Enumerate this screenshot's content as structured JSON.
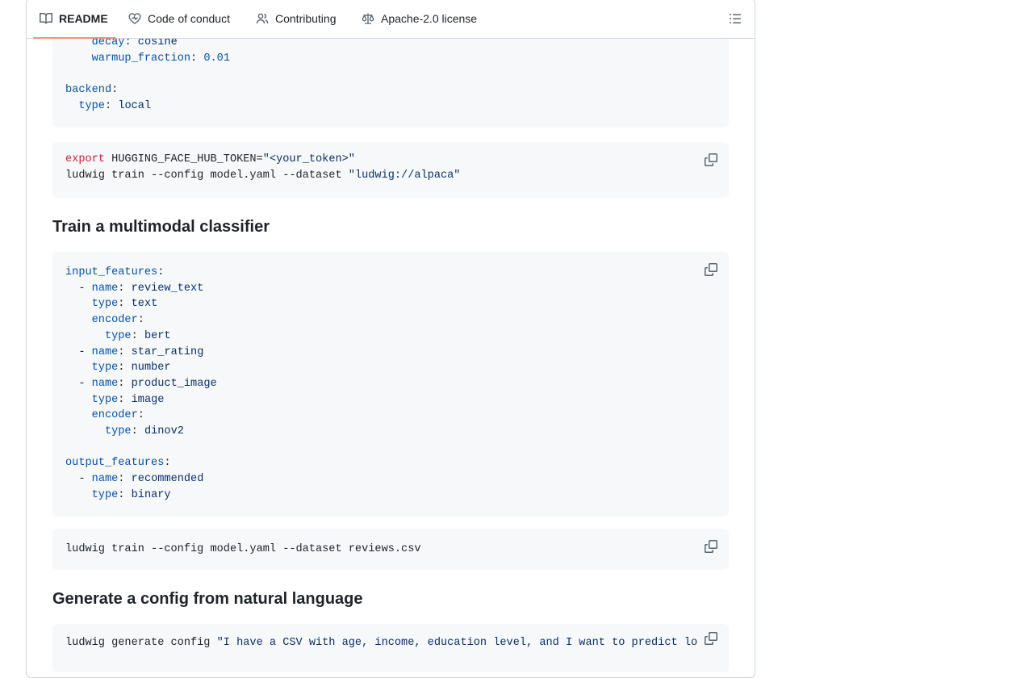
{
  "tabs": [
    {
      "label": "README",
      "icon": "book-icon",
      "active": true
    },
    {
      "label": "Code of conduct",
      "icon": "heart-icon",
      "active": false
    },
    {
      "label": "Contributing",
      "icon": "people-icon",
      "active": false
    },
    {
      "label": "Apache-2.0 license",
      "icon": "law-icon",
      "active": false
    }
  ],
  "outline_icon": "list-unordered-icon",
  "block1": {
    "lines": [
      {
        "indent": "    ",
        "key": "decay",
        "value": "cosine"
      },
      {
        "indent": "    ",
        "key": "warmup_fraction",
        "value": "0.01"
      },
      {
        "blank": true
      },
      {
        "indent": "",
        "key": "backend",
        "value": ""
      },
      {
        "indent": "  ",
        "key": "type",
        "value": "local"
      }
    ]
  },
  "block2": {
    "export_kw": "export",
    "env_assign": " HUGGING_FACE_HUB_TOKEN=",
    "env_value": "\"<your_token>\"",
    "cmd": "ludwig train --config model.yaml --dataset ",
    "dataset": "\"ludwig://alpaca\""
  },
  "heading_multimodal": "Train a multimodal classifier",
  "block3": {
    "lines": [
      {
        "indent": "",
        "dash": false,
        "key": "input_features",
        "value": ""
      },
      {
        "indent": "  ",
        "dash": true,
        "key": "name",
        "value": "review_text"
      },
      {
        "indent": "    ",
        "dash": false,
        "key": "type",
        "value": "text"
      },
      {
        "indent": "    ",
        "dash": false,
        "key": "encoder",
        "value": ""
      },
      {
        "indent": "      ",
        "dash": false,
        "key": "type",
        "value": "bert"
      },
      {
        "indent": "  ",
        "dash": true,
        "key": "name",
        "value": "star_rating"
      },
      {
        "indent": "    ",
        "dash": false,
        "key": "type",
        "value": "number"
      },
      {
        "indent": "  ",
        "dash": true,
        "key": "name",
        "value": "product_image"
      },
      {
        "indent": "    ",
        "dash": false,
        "key": "type",
        "value": "image"
      },
      {
        "indent": "    ",
        "dash": false,
        "key": "encoder",
        "value": ""
      },
      {
        "indent": "      ",
        "dash": false,
        "key": "type",
        "value": "dinov2"
      },
      {
        "blank": true
      },
      {
        "indent": "",
        "dash": false,
        "key": "output_features",
        "value": ""
      },
      {
        "indent": "  ",
        "dash": true,
        "key": "name",
        "value": "recommended"
      },
      {
        "indent": "    ",
        "dash": false,
        "key": "type",
        "value": "binary"
      }
    ]
  },
  "block4": {
    "cmd": "ludwig train --config model.yaml --dataset reviews.csv"
  },
  "heading_generate": "Generate a config from natural language",
  "block5": {
    "cmd": "ludwig generate config ",
    "prompt": "\"I have a CSV with age, income, education level, and I want to predict lo"
  },
  "colors": {
    "accent_underline": "#fd8c73",
    "yaml_key": "#0550ae",
    "string": "#0a3069",
    "keyword": "#cf222e",
    "code_bg": "#f6f8fa"
  }
}
